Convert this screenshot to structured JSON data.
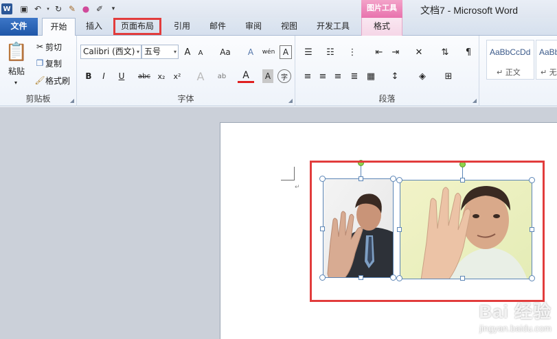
{
  "window": {
    "title": "文档7 - Microsoft Word",
    "context_header": "图片工具"
  },
  "qat": {
    "icons": [
      "word-logo-icon",
      "save-icon",
      "undo-icon",
      "redo-icon",
      "format-painter-icon",
      "color-icon",
      "pen-icon",
      "customize-icon"
    ]
  },
  "tabs": {
    "file": "文件",
    "home": "开始",
    "insert": "插入",
    "layout": "页面布局",
    "references": "引用",
    "mailings": "邮件",
    "review": "审阅",
    "view": "视图",
    "developer": "开发工具",
    "format": "格式"
  },
  "clipboard": {
    "paste": "粘贴",
    "cut": "剪切",
    "copy": "复制",
    "painter": "格式刷",
    "label": "剪贴板"
  },
  "font": {
    "name": "Calibri (西文)",
    "size": "五号",
    "label": "字体",
    "grow": "A",
    "shrink": "A",
    "case": "Aa",
    "clear": "A",
    "pinyin": "wén",
    "border_char": "A",
    "bold": "B",
    "italic": "I",
    "underline": "U",
    "strike": "abc",
    "sub": "x₂",
    "sup": "x²",
    "effects": "A",
    "highlight": "ab",
    "color": "A",
    "shade": "A",
    "circle": "字"
  },
  "paragraph": {
    "label": "段落"
  },
  "styles": {
    "items": [
      {
        "sample": "AaBbCcDd",
        "name": "↵ 正文"
      },
      {
        "sample": "AaBb",
        "name": "↵ 无"
      }
    ]
  },
  "watermark": {
    "brand": "Bai 经验",
    "url": "jingyan.baidu.com"
  },
  "colors": {
    "accent_red": "#e23c3c",
    "file_tab": "#2b63b5",
    "context_pink": "#e872ad"
  }
}
